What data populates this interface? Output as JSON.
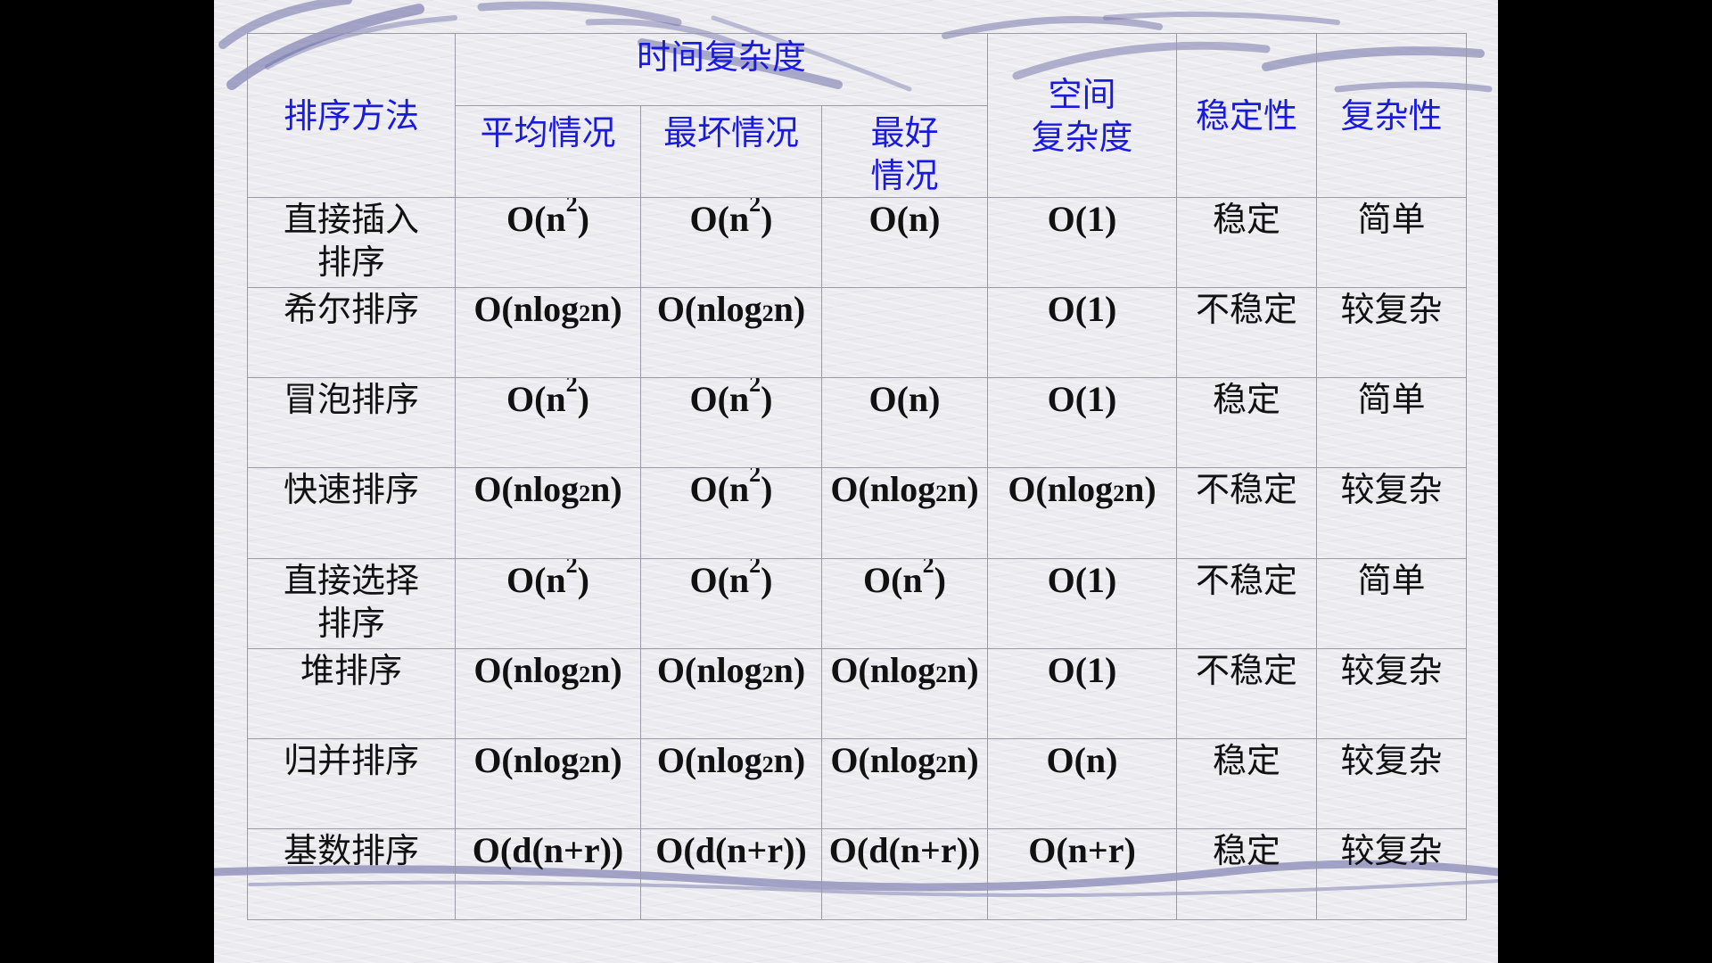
{
  "table": {
    "headers": {
      "method": "排序方法",
      "time": "时间复杂度",
      "average": "平均情况",
      "worst": "最坏情况",
      "best_line1": "最好",
      "best_line2": "情况",
      "space_line1": "空间",
      "space_line2": "复杂度",
      "stability": "稳定性",
      "complexity": "复杂性"
    },
    "rows": [
      {
        "name_line1": "直接插入",
        "name_line2": "排序",
        "average": {
          "base": "O(n",
          "exp": "2",
          "tail": ")"
        },
        "worst": {
          "base": "O(n",
          "exp": "2",
          "tail": ")"
        },
        "best": {
          "base": "O(n)"
        },
        "space": {
          "base": "O(1)"
        },
        "stability": "稳定",
        "complexity": "简单"
      },
      {
        "name_line1": "希尔排序",
        "name_line2": "",
        "average": {
          "base": "O(nlog",
          "sub": "2",
          "tail": "n)"
        },
        "worst": {
          "base": "O(nlog",
          "sub": "2",
          "tail": "n)"
        },
        "best": {
          "base": ""
        },
        "space": {
          "base": "O(1)"
        },
        "stability": "不稳定",
        "complexity": "较复杂"
      },
      {
        "name_line1": "冒泡排序",
        "name_line2": "",
        "average": {
          "base": "O(n",
          "exp": "2",
          "tail": ")"
        },
        "worst": {
          "base": "O(n",
          "exp": "2",
          "tail": ")"
        },
        "best": {
          "base": "O(n)"
        },
        "space": {
          "base": "O(1)"
        },
        "stability": "稳定",
        "complexity": "简单"
      },
      {
        "name_line1": "快速排序",
        "name_line2": "",
        "average": {
          "base": "O(nlog",
          "sub": "2",
          "tail": "n)"
        },
        "worst": {
          "base": "O(n",
          "exp": "2",
          "tail": ")"
        },
        "best": {
          "base": "O(nlog",
          "sub": "2",
          "tail": "n)"
        },
        "space": {
          "base": "O(nlog",
          "sub": "2",
          "tail": "n)"
        },
        "stability": "不稳定",
        "complexity": "较复杂"
      },
      {
        "name_line1": "直接选择",
        "name_line2": "排序",
        "average": {
          "base": "O(n",
          "exp": "2",
          "tail": ")"
        },
        "worst": {
          "base": "O(n",
          "exp": "2",
          "tail": ")"
        },
        "best": {
          "base": "O(n",
          "exp": "2",
          "tail": ")"
        },
        "space": {
          "base": "O(1)"
        },
        "stability": "不稳定",
        "complexity": "简单"
      },
      {
        "name_line1": "堆排序",
        "name_line2": "",
        "average": {
          "base": "O(nlog",
          "sub": "2",
          "tail": "n)"
        },
        "worst": {
          "base": "O(nlog",
          "sub": "2",
          "tail": "n)"
        },
        "best": {
          "base": "O(nlog",
          "sub": "2",
          "tail": "n)"
        },
        "space": {
          "base": "O(1)"
        },
        "stability": "不稳定",
        "complexity": "较复杂"
      },
      {
        "name_line1": "归并排序",
        "name_line2": "",
        "average": {
          "base": "O(nlog",
          "sub": "2",
          "tail": "n)"
        },
        "worst": {
          "base": "O(nlog",
          "sub": "2",
          "tail": "n)"
        },
        "best": {
          "base": "O(nlog",
          "sub": "2",
          "tail": "n)"
        },
        "space": {
          "base": "O(n)"
        },
        "stability": "稳定",
        "complexity": "较复杂"
      },
      {
        "name_line1": "基数排序",
        "name_line2": "",
        "average": {
          "base": "O(d(n+r))"
        },
        "worst": {
          "base": "O(d(n+r))"
        },
        "best": {
          "base": "O(d(n+r))"
        },
        "space": {
          "base": "O(n+r)"
        },
        "stability": "稳定",
        "complexity": "较复杂"
      }
    ]
  },
  "colors": {
    "header_text": "#1a1adc",
    "body_text": "#111111",
    "grid_line": "#9a9aa6",
    "swoosh": "#6f6fa8",
    "background": "#ececf0"
  }
}
